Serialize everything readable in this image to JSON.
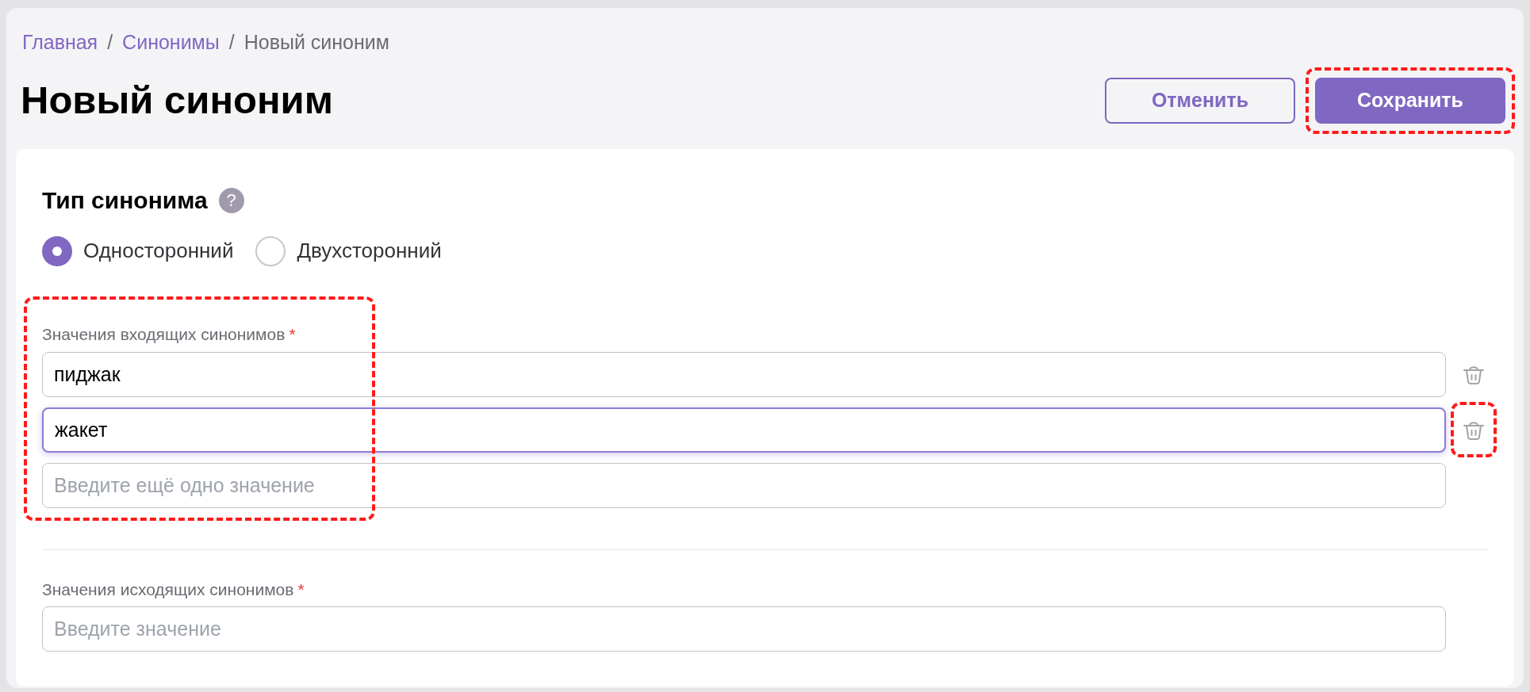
{
  "breadcrumbs": [
    {
      "label": "Главная",
      "link": true
    },
    {
      "label": "Синонимы",
      "link": true
    },
    {
      "label": "Новый синоним",
      "link": false
    }
  ],
  "breadcrumb_separator": "/",
  "title": "Новый синоним",
  "buttons": [
    {
      "label": "Отменить",
      "kind": "secondary",
      "highlighted": false
    },
    {
      "label": "Сохранить",
      "kind": "primary",
      "highlighted": true
    }
  ],
  "synonym_type": {
    "label": "Тип синонима",
    "help": "?",
    "options": [
      {
        "label": "Односторонний",
        "selected": true
      },
      {
        "label": "Двухсторонний",
        "selected": false
      }
    ]
  },
  "incoming": {
    "label": "Значения входящих синонимов",
    "required": "*",
    "highlighted": true,
    "fields": [
      {
        "value": "пиджак",
        "focused": false,
        "deletable": true,
        "delete_highlighted": false
      },
      {
        "value": "жакет",
        "focused": true,
        "deletable": true,
        "delete_highlighted": true
      },
      {
        "placeholder": "Введите ещё одно значение",
        "focused": false,
        "deletable": false,
        "delete_highlighted": false
      }
    ]
  },
  "outgoing": {
    "label": "Значения исходящих синонимов",
    "required": "*",
    "fields": [
      {
        "placeholder": "Введите значение",
        "focused": false,
        "deletable": false
      }
    ]
  }
}
